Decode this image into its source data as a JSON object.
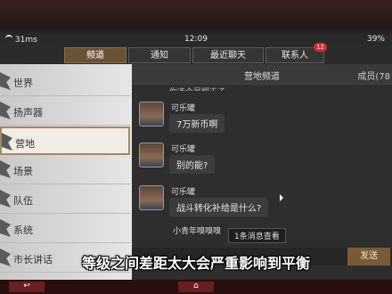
{
  "status": {
    "signal": "31ms",
    "time": "12:09",
    "battery": "39%"
  },
  "tabs": [
    {
      "label": "频道",
      "active": true
    },
    {
      "label": "通知"
    },
    {
      "label": "最近聊天"
    },
    {
      "label": "联系人",
      "badge": "12"
    }
  ],
  "sidebar": {
    "items": [
      {
        "label": "世界"
      },
      {
        "label": "扬声器"
      },
      {
        "label": "营地",
        "active": true
      },
      {
        "label": "场景"
      },
      {
        "label": "队伍"
      },
      {
        "label": "系统"
      },
      {
        "label": "市长讲话"
      }
    ]
  },
  "main": {
    "title": "营地频道",
    "members": "成员(78",
    "top_partial": "你选个是耀天子",
    "messages": [
      {
        "sender": "可乐罐",
        "text": "7万新币啊"
      },
      {
        "sender": "可乐罐",
        "text": "别的能?"
      },
      {
        "sender": "可乐罐",
        "text": "战斗转化补给是什么?"
      }
    ],
    "partial_sender": "小青年嗅嗅嗅",
    "new_msg": "1条消息查看"
  },
  "send_label": "发送",
  "subtitle": "等级之间差距太大会严重影响到平衡",
  "colors": {
    "accent": "#7a5a35",
    "badge": "#d92a2a"
  }
}
